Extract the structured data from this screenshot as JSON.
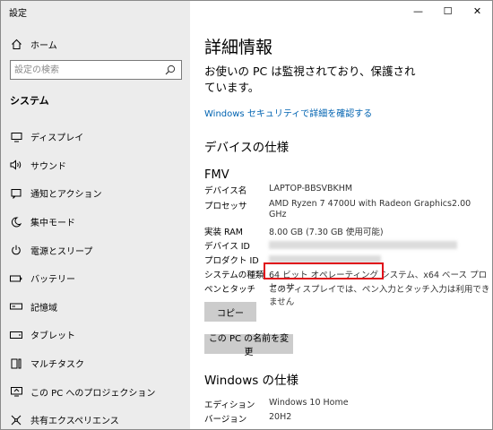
{
  "app_title": "設定",
  "window_controls": {
    "minimize": "—",
    "maximize": "☐",
    "close": "✕"
  },
  "sidebar": {
    "home_label": "ホーム",
    "search_placeholder": "設定の検索",
    "section_label": "システム",
    "items": [
      {
        "label": "ディスプレイ",
        "icon": "display-icon"
      },
      {
        "label": "サウンド",
        "icon": "sound-icon"
      },
      {
        "label": "通知とアクション",
        "icon": "notification-icon"
      },
      {
        "label": "集中モード",
        "icon": "focus-moon-icon"
      },
      {
        "label": "電源とスリープ",
        "icon": "power-icon"
      },
      {
        "label": "バッテリー",
        "icon": "battery-icon"
      },
      {
        "label": "記憶域",
        "icon": "storage-icon"
      },
      {
        "label": "タブレット",
        "icon": "tablet-icon"
      },
      {
        "label": "マルチタスク",
        "icon": "multitask-icon"
      },
      {
        "label": "この PC へのプロジェクション",
        "icon": "projection-icon"
      },
      {
        "label": "共有エクスペリエンス",
        "icon": "shared-icon"
      }
    ]
  },
  "main": {
    "title": "詳細情報",
    "protection_text": "お使いの PC は監視されており、保護されています。",
    "security_link": "Windows セキュリティで詳細を確認する",
    "device_specs_heading": "デバイスの仕様",
    "brand": "FMV",
    "specs": {
      "device_name_label": "デバイス名",
      "device_name_value": "LAPTOP-BBSVBKHM",
      "processor_label": "プロセッサ",
      "processor_value": "AMD Ryzen 7 4700U with Radeon Graphics",
      "processor_speed": "2.00",
      "processor_unit": "GHz",
      "ram_label": "実装 RAM",
      "ram_value": "8.00 GB (7.30 GB 使用可能)",
      "device_id_label": "デバイス ID",
      "product_id_label": "プロダクト ID",
      "system_type_label": "システムの種類",
      "system_type_value": "64 ビット オペレーティング システム、x64 ベース プロセッサ",
      "pen_touch_label": "ペンとタッチ",
      "pen_touch_value": "このディスプレイでは、ペン入力とタッチ入力は利用できません"
    },
    "copy_button": "コピー",
    "rename_button": "この PC の名前を変更",
    "windows_specs_heading": "Windows の仕様",
    "windows_specs": {
      "edition_label": "エディション",
      "edition_value": "Windows 10 Home",
      "version_label": "バージョン",
      "version_value": "20H2"
    }
  }
}
